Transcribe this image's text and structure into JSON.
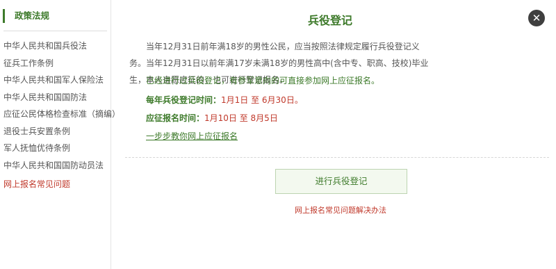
{
  "sidebar": {
    "heading": "政策法规",
    "items": [
      "中华人民共和国兵役法",
      "征兵工作条例",
      "中华人民共和国军人保险法",
      "中华人民共和国国防法",
      "应征公民体格检查标准（摘编）",
      "退役士兵安置条例",
      "军人抚恤优待条例",
      "中华人民共和国国防动员法"
    ],
    "faq": "网上报名常见问题"
  },
  "main": {
    "title": "兵役登记",
    "close_symbol": "✕",
    "intro": "当年12月31日前年满18岁的男性公民，应当按照法律规定履行兵役登记义务。当年12月31日以前年满17岁未满18岁的男性高中(含中专、职高、技校)毕业生，本人自愿应征的，也可进行登记报名。",
    "intro2": "已经进行过兵役登记，有参军意向的可直接参加网上应征报名。",
    "registration_time_label": "每年兵役登记时间：",
    "registration_time_value": "1月1日 至 6月30日。",
    "enlistment_time_label": "应征报名时间：",
    "enlistment_time_value": "1月10日 至 8月5日",
    "guide_link": "一步步教你网上应征报名",
    "register_button": "进行兵役登记",
    "faq_link": "网上报名常见问题解决办法"
  },
  "colors": {
    "accent_green": "#3d7a2a",
    "link_red": "#c0392b",
    "close_bg": "#3f3f3f"
  }
}
